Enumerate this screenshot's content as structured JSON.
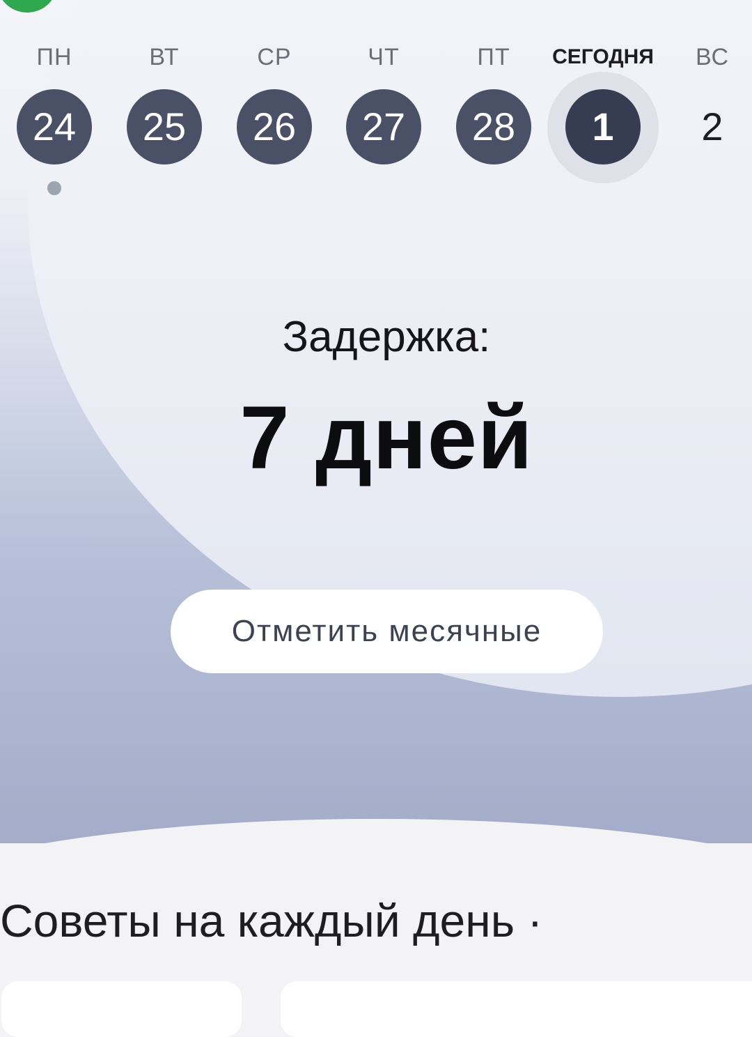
{
  "week": {
    "days": [
      {
        "name": "ПН",
        "date": "24",
        "state": "past",
        "has_dot": true
      },
      {
        "name": "ВТ",
        "date": "25",
        "state": "past"
      },
      {
        "name": "СР",
        "date": "26",
        "state": "past"
      },
      {
        "name": "ЧТ",
        "date": "27",
        "state": "past"
      },
      {
        "name": "ПТ",
        "date": "28",
        "state": "past"
      },
      {
        "name": "СЕГОДНЯ",
        "date": "1",
        "state": "today"
      },
      {
        "name": "ВС",
        "date": "2",
        "state": "future"
      }
    ]
  },
  "status": {
    "label": "Задержка:",
    "value": "7 дней"
  },
  "actions": {
    "mark_period_label": "Отметить месячные"
  },
  "tips": {
    "title": "Советы на каждый день ·"
  },
  "colors": {
    "accent_green": "#2fa84f",
    "day_circle": "#4a5166",
    "today_circle": "#363d52"
  }
}
